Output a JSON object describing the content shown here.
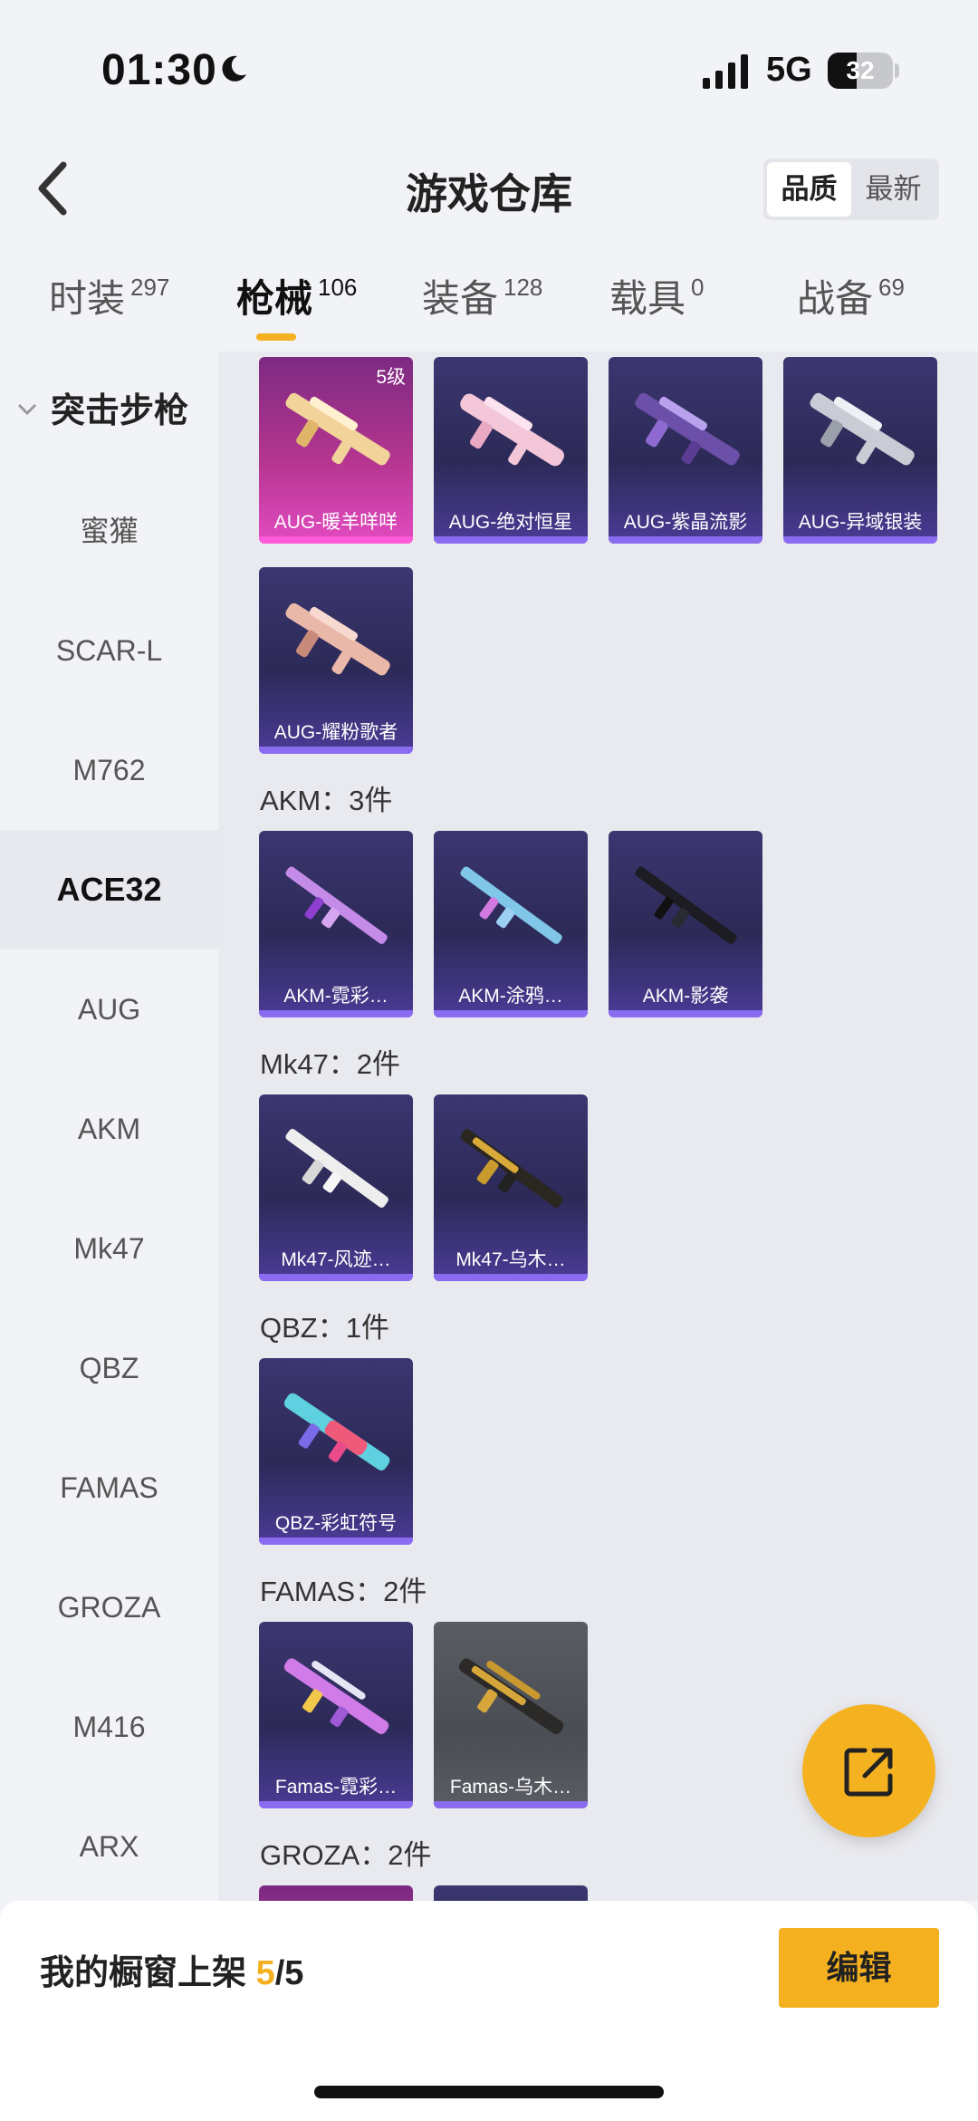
{
  "status_bar": {
    "time": "01:30",
    "network": "5G",
    "battery": "32"
  },
  "header": {
    "title": "游戏仓库",
    "sort_options": [
      {
        "label": "品质",
        "active": true
      },
      {
        "label": "最新",
        "active": false
      }
    ]
  },
  "tabs": [
    {
      "label": "时装",
      "count": "297",
      "active": false
    },
    {
      "label": "枪械",
      "count": "106",
      "active": true
    },
    {
      "label": "装备",
      "count": "128",
      "active": false
    },
    {
      "label": "载具",
      "count": "0",
      "active": false
    },
    {
      "label": "战备",
      "count": "69",
      "active": false
    }
  ],
  "sidebar": {
    "group": "突击步枪",
    "items": [
      "蜜獾",
      "SCAR-L",
      "M762",
      "ACE32",
      "AUG",
      "AKM",
      "Mk47",
      "QBZ",
      "FAMAS",
      "GROZA",
      "M416",
      "ARX"
    ],
    "active": "ACE32"
  },
  "content": {
    "aug_items": [
      {
        "name": "AUG-暖羊咩咩",
        "level": "5级",
        "style": "pink",
        "icon": "aug-rifle-gold"
      },
      {
        "name": "AUG-绝对恒星",
        "style": "purple",
        "icon": "aug-rifle-pink"
      },
      {
        "name": "AUG-紫晶流影",
        "style": "purple",
        "icon": "aug-rifle-violet"
      },
      {
        "name": "AUG-异域银装",
        "style": "purple",
        "icon": "aug-rifle-silver"
      },
      {
        "name": "AUG-耀粉歌者",
        "style": "purple",
        "icon": "aug-rifle-rose"
      }
    ],
    "sections": [
      {
        "label": "AKM：3件",
        "items": [
          {
            "name": "AKM-霓彩…",
            "icon": "akm-rifle"
          },
          {
            "name": "AKM-涂鸦…",
            "icon": "akm-rifle"
          },
          {
            "name": "AKM-影袭",
            "icon": "akm-rifle-black"
          }
        ]
      },
      {
        "label": "Mk47：2件",
        "items": [
          {
            "name": "Mk47-风迹…",
            "icon": "mk47-rifle-white"
          },
          {
            "name": "Mk47-乌木…",
            "icon": "mk47-rifle-gold"
          }
        ]
      },
      {
        "label": "QBZ：1件",
        "items": [
          {
            "name": "QBZ-彩虹符号",
            "icon": "qbz-rifle"
          }
        ]
      },
      {
        "label": "FAMAS：2件",
        "items": [
          {
            "name": "Famas-霓彩…",
            "icon": "famas-rifle"
          },
          {
            "name": "Famas-乌木…",
            "icon": "famas-rifle-gold",
            "style": "grey"
          }
        ]
      },
      {
        "label": "GROZA：2件",
        "items": []
      }
    ]
  },
  "fab": {
    "icon": "share-out-icon"
  },
  "bottom_bar": {
    "label": "我的橱窗上架",
    "count_current": "5",
    "count_total": "/5",
    "edit_label": "编辑"
  },
  "colors": {
    "accent": "#f5b020",
    "card_purple": "#2c2a57",
    "card_pink": "#b4358f"
  }
}
